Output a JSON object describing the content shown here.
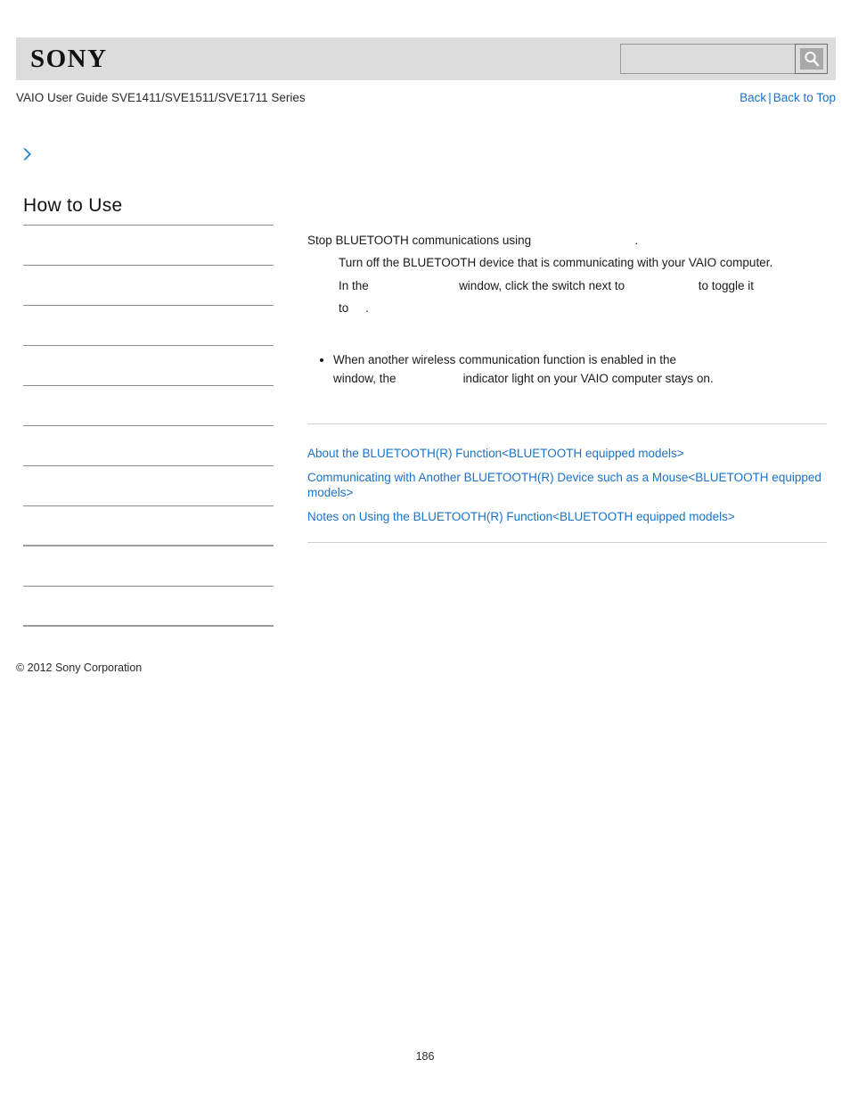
{
  "header": {
    "logo_text": "SONY",
    "search": {
      "value": "",
      "placeholder": "",
      "icon": "search-icon"
    }
  },
  "guide": {
    "title": "VAIO User Guide SVE1411/SVE1511/SVE1711 Series",
    "links": {
      "back": "Back",
      "separator": "|",
      "back_to_top": "Back to Top"
    }
  },
  "breadcrumb": {
    "icon": "chevron-right-icon",
    "text": ""
  },
  "sidebar": {
    "title": "How to Use",
    "items": [
      {
        "label": ""
      },
      {
        "label": ""
      },
      {
        "label": ""
      },
      {
        "label": ""
      },
      {
        "label": ""
      },
      {
        "label": ""
      },
      {
        "label": ""
      },
      {
        "label": ""
      },
      {
        "label": ""
      },
      {
        "label": ""
      }
    ]
  },
  "content": {
    "intro_before": "Stop BLUETOOTH communications using",
    "intro_gap": "                               ",
    "intro_after": ".",
    "steps": [
      {
        "text": "Turn off the BLUETOOTH device that is communicating with your VAIO computer."
      },
      {
        "part1": "In the",
        "gap1": "                           ",
        "part2": "window, click the switch next to",
        "gap2": "                      ",
        "part3": "to toggle it",
        "part4": "to",
        "gap3": "     ",
        "part5": "."
      }
    ],
    "notes": [
      {
        "line1": "When another wireless communication function is enabled in the",
        "line2_before": "window, the",
        "line2_gap": "                    ",
        "line2_after": "indicator light on your VAIO computer stays on."
      }
    ],
    "related_links": [
      "About the BLUETOOTH(R) Function<BLUETOOTH equipped models>",
      "Communicating with Another BLUETOOTH(R) Device such as a Mouse<BLUETOOTH equipped models>",
      "Notes on Using the BLUETOOTH(R) Function<BLUETOOTH equipped models>"
    ]
  },
  "footer": {
    "copyright": "© 2012 Sony Corporation",
    "page_number": "186"
  },
  "colors": {
    "link_blue": "#1a72c8",
    "header_bg": "#dcdcdc",
    "rule_gray": "#cfcfcf",
    "nav_rule": "#8c8c8c"
  }
}
